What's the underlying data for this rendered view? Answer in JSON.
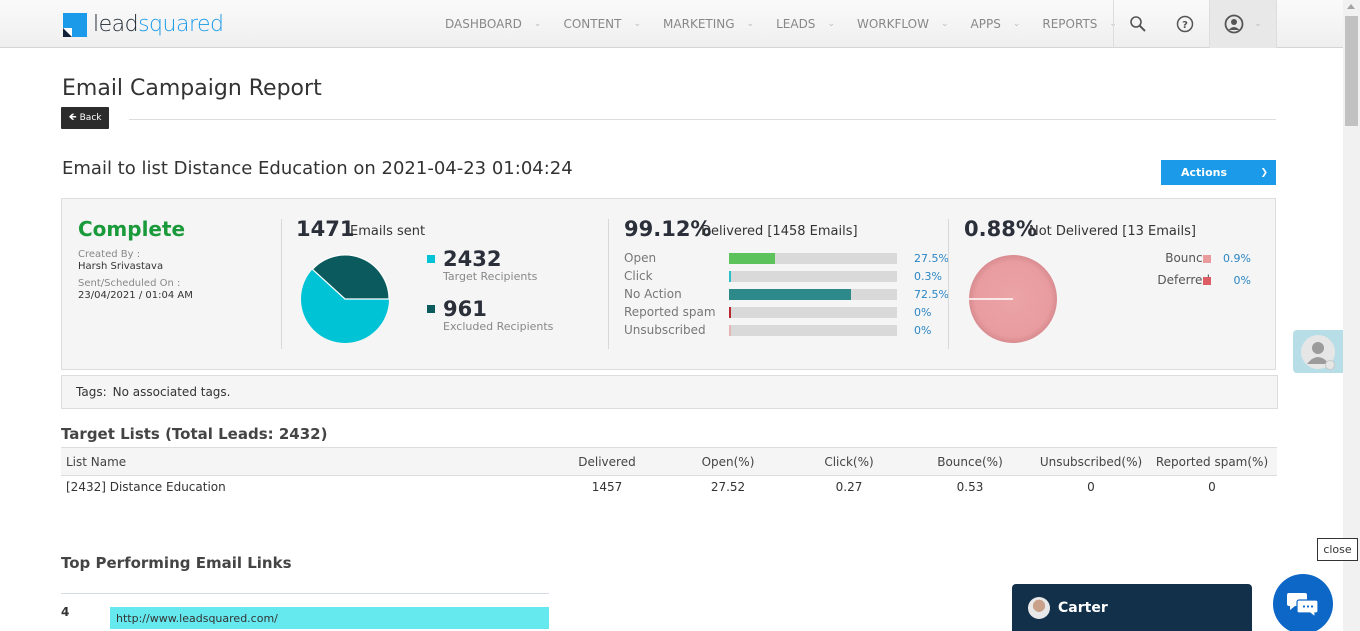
{
  "brand": {
    "part1": "lead",
    "part2": "squared",
    "primary": "#1a9ae8",
    "dark": "#1d2833"
  },
  "nav": {
    "items": [
      {
        "label": "DASHBOARD"
      },
      {
        "label": "CONTENT"
      },
      {
        "label": "MARKETING"
      },
      {
        "label": "LEADS"
      },
      {
        "label": "WORKFLOW"
      },
      {
        "label": "APPS"
      },
      {
        "label": "REPORTS"
      }
    ],
    "icons": [
      "search-icon",
      "help-icon",
      "user-icon"
    ]
  },
  "page": {
    "title": "Email Campaign Report",
    "back_label": "Back",
    "campaign_title": "Email to list Distance Education on 2021-04-23 01:04:24",
    "actions_label": "Actions"
  },
  "summary": {
    "status": "Complete",
    "status_color": "#1a9a3a",
    "created_by_label": "Created By :",
    "created_by": "Harsh Srivastava",
    "sent_label": "Sent/Scheduled On :",
    "sent_on": "23/04/2021 / 01:04 AM",
    "emails_sent": "1471",
    "emails_sent_label": "Emails sent",
    "recipients": [
      {
        "value": "2432",
        "label": "Target Recipients",
        "color": "#00c4d6"
      },
      {
        "value": "961",
        "label": "Excluded Recipients",
        "color": "#0b5a5e"
      }
    ],
    "delivered": {
      "pct": "99.12%",
      "label": "Delivered [1458 Emails]",
      "rows": [
        {
          "label": "Open",
          "value": "27.5%",
          "fraction": 0.275,
          "color": "#5cc25c"
        },
        {
          "label": "Click",
          "value": "0.3%",
          "fraction": 0.012,
          "color": "#2bbfc9"
        },
        {
          "label": "No Action",
          "value": "72.5%",
          "fraction": 0.725,
          "color": "#2e8a8a"
        },
        {
          "label": "Reported spam",
          "value": "0%",
          "fraction": 0.012,
          "color": "#b8282e"
        },
        {
          "label": "Unsubscribed",
          "value": "0%",
          "fraction": 0.012,
          "color": "#e8b5b7"
        }
      ]
    },
    "not_delivered": {
      "pct": "0.88%",
      "label": "Not Delivered [13 Emails]",
      "rows": [
        {
          "label": "Bounce",
          "value": "0.9%",
          "color": "#e89a9c"
        },
        {
          "label": "Deferred",
          "value": "0%",
          "color": "#dc5d64"
        }
      ]
    }
  },
  "tags": {
    "label": "Tags:",
    "value": "No associated tags."
  },
  "target_lists": {
    "title": "Target Lists (Total Leads: 2432)",
    "columns": [
      "List Name",
      "Delivered",
      "Open(%)",
      "Click(%)",
      "Bounce(%)",
      "Unsubscribed(%)",
      "Reported spam(%)"
    ],
    "rows": [
      [
        "[2432] Distance Education",
        "1457",
        "27.52",
        "0.27",
        "0.53",
        "0",
        "0"
      ]
    ]
  },
  "top_links": {
    "title": "Top Performing Email Links",
    "items": [
      {
        "rank": "4",
        "url": "http://www.leadsquared.com/"
      }
    ]
  },
  "widgets": {
    "close_label": "close",
    "chat_agent": "Carter"
  }
}
